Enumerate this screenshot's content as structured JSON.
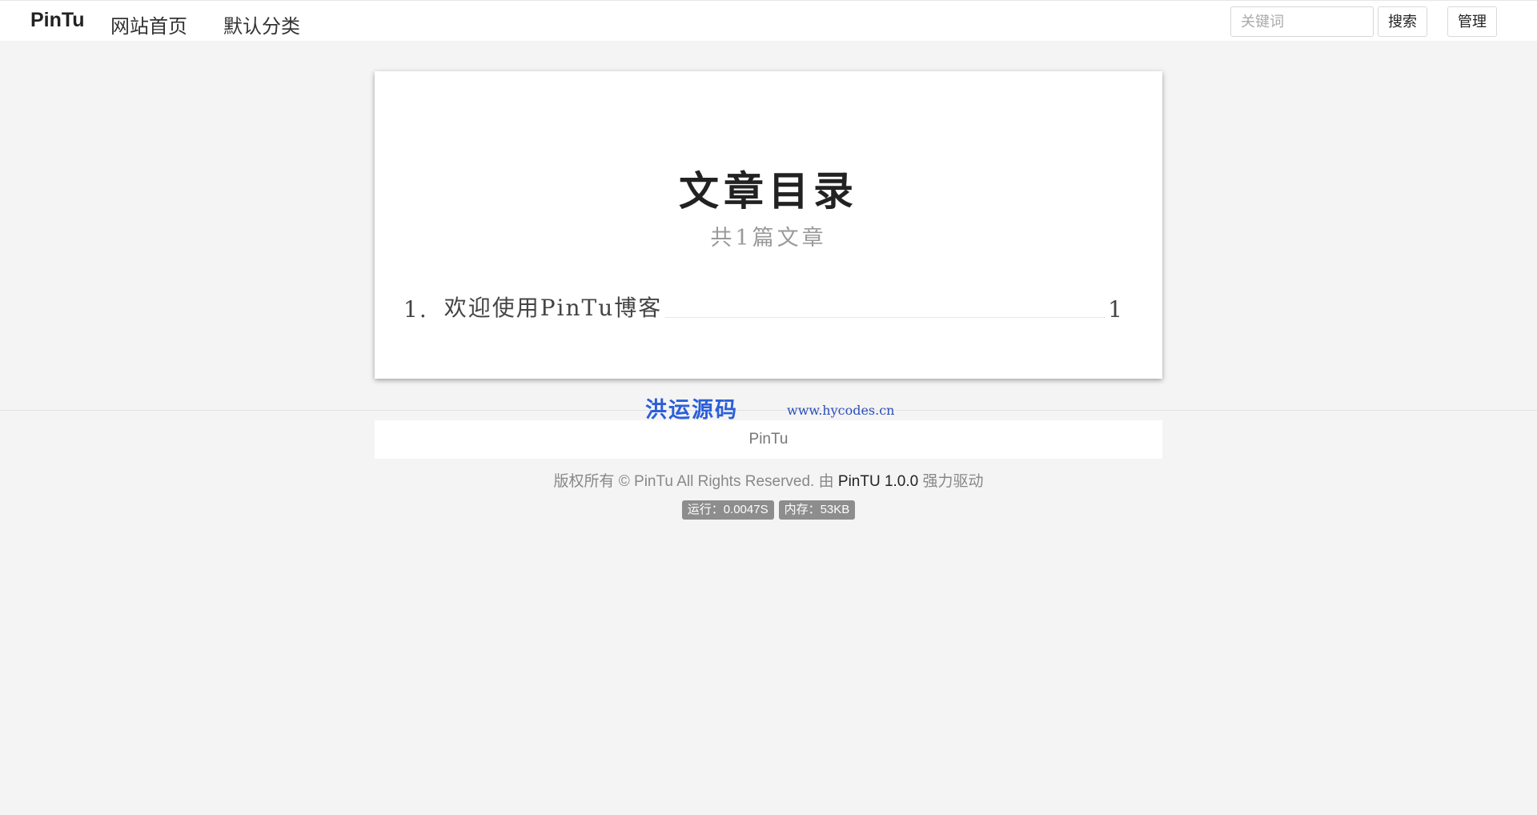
{
  "navbar": {
    "brand": "PinTu",
    "links": [
      "网站首页",
      "默认分类"
    ],
    "search_placeholder": "关键词",
    "search_button": "搜索",
    "admin_button": "管理"
  },
  "catalog": {
    "title": "文章目录",
    "subtitle": "共1篇文章",
    "items": [
      {
        "index": "1.",
        "title": "欢迎使用PinTu博客",
        "page": "1"
      }
    ]
  },
  "watermark": {
    "name": "洪运源码",
    "url": "www.hycodes.cn",
    "color": "#2b5fd9"
  },
  "footer": {
    "site_name": "PinTu",
    "copyright_prefix": "版权所有 © PinTu All Rights Reserved. 由",
    "powered_link": "PinTU 1.0.0",
    "copyright_suffix": "强力驱动",
    "runtime": "运行：0.0047S",
    "memory": "内存：53KB"
  }
}
